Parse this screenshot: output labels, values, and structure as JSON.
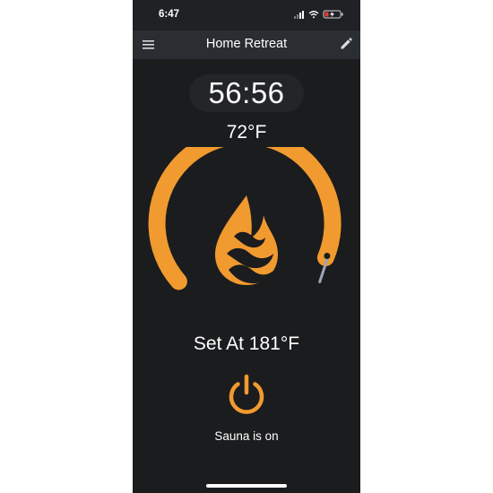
{
  "status_bar": {
    "time": "6:47",
    "icons": [
      "signal-icon",
      "wifi-icon",
      "battery-charging-icon"
    ]
  },
  "header": {
    "title": "Home Retreat",
    "menu_icon": "menu-icon",
    "edit_icon": "edit-pencil-icon"
  },
  "timer": {
    "value": "56:56"
  },
  "temperature": {
    "current": "72°F",
    "setpoint_label": "Set At 181°F"
  },
  "status": {
    "text": "Sauna is on"
  },
  "colors": {
    "accent": "#f19a2f",
    "background": "#1b1c1e",
    "header": "#2a2d31",
    "knob": "#9aa6b8"
  }
}
